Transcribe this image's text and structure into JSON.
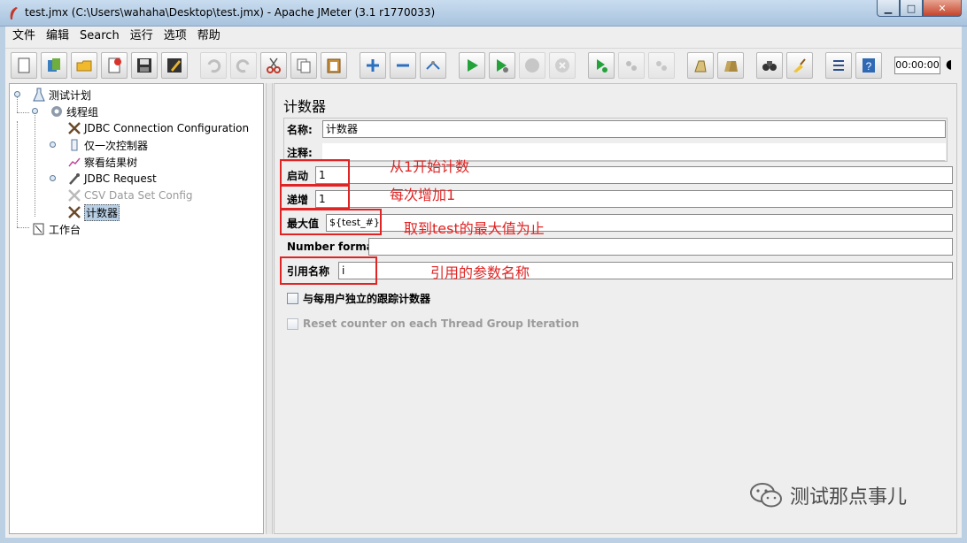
{
  "window": {
    "title": "test.jmx (C:\\Users\\wahaha\\Desktop\\test.jmx) - Apache JMeter (3.1 r1770033)",
    "min_glyph": "▁",
    "max_glyph": "□",
    "close_glyph": "✕"
  },
  "menu": [
    "文件",
    "编辑",
    "Search",
    "运行",
    "选项",
    "帮助"
  ],
  "toolbar": {
    "timer": "00:00:00",
    "icons": [
      "new-icon",
      "templates-icon",
      "open-icon",
      "close-file-icon",
      "save-icon",
      "save-as-icon",
      "undo-icon",
      "redo-icon",
      "cut-icon",
      "copy-icon",
      "paste-icon",
      "expand-icon",
      "collapse-icon",
      "toggle-icon",
      "start-icon",
      "start-no-pause-icon",
      "stop-icon",
      "shutdown-icon",
      "remote-start-icon",
      "remote-stop-icon",
      "remote-shutdown-icon",
      "clear-icon",
      "clear-all-icon",
      "search-icon",
      "reset-search-icon",
      "function-helper-icon",
      "help-icon"
    ]
  },
  "tree": {
    "nodes": [
      {
        "label": "测试计划"
      },
      {
        "label": "线程组"
      },
      {
        "label": "JDBC Connection Configuration"
      },
      {
        "label": "仅一次控制器"
      },
      {
        "label": "察看结果树"
      },
      {
        "label": "JDBC Request"
      },
      {
        "label": "CSV Data Set Config"
      },
      {
        "label": "计数器"
      },
      {
        "label": "工作台"
      }
    ]
  },
  "panel": {
    "title": "计数器",
    "name_label": "名称:",
    "name_value": "计数器",
    "comment_label": "注释:",
    "start_label": "启动",
    "start_value": "1",
    "increment_label": "递增",
    "increment_value": "1",
    "max_label": "最大值",
    "max_value": "${test_#}",
    "format_label": "Number format",
    "format_value": "",
    "ref_label": "引用名称",
    "ref_value": "i",
    "per_user_label": "与每用户独立的跟踪计数器",
    "reset_label": "Reset counter on each Thread Group Iteration"
  },
  "annotations": {
    "start": "从1开始计数",
    "increment": "每次增加1",
    "max": "取到test的最大值为止",
    "ref": "引用的参数名称"
  },
  "watermark": "测试那点事儿",
  "colors": {
    "annotation": "#e02424",
    "selection": "#b8cfe5"
  }
}
